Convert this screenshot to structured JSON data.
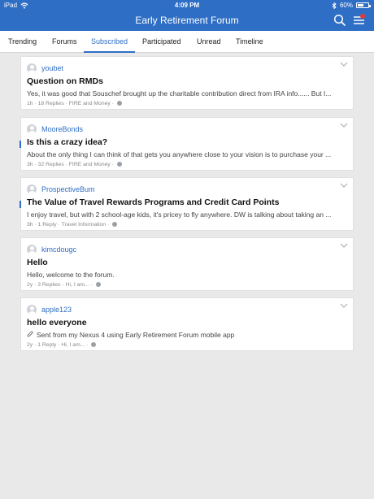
{
  "status_bar": {
    "carrier": "iPad",
    "time": "4:09 PM",
    "battery": "60%",
    "battery_level": 0.6
  },
  "header": {
    "title": "Early Retirement Forum",
    "icons": [
      "search-icon",
      "menu-icon"
    ]
  },
  "tabs": [
    {
      "label": "Trending",
      "active": false
    },
    {
      "label": "Forums",
      "active": false
    },
    {
      "label": "Subscribed",
      "active": true
    },
    {
      "label": "Participated",
      "active": false
    },
    {
      "label": "Unread",
      "active": false
    },
    {
      "label": "Timeline",
      "active": false
    }
  ],
  "topics": [
    {
      "author": "youbet",
      "title": "Question on RMDs",
      "excerpt": "Yes, it was good that Souschef brought up the charitable contribution direct from IRA info...... But I...",
      "age": "1h",
      "replies": "18 Replies",
      "forum": "FIRE and Money",
      "unread": false
    },
    {
      "author": "MooreBonds",
      "title": "Is this a crazy idea?",
      "excerpt": "About the only thing I can think of that gets you anywhere close to your vision is to purchase your ...",
      "age": "3h",
      "replies": "32 Replies",
      "forum": "FIRE and Money",
      "unread": true
    },
    {
      "author": "ProspectiveBum",
      "title": "The Value of Travel Rewards Programs and Credit Card Points",
      "excerpt": "I enjoy travel, but with 2 school-age kids, it's pricey to fly anywhere. DW is talking about taking an ...",
      "age": "3h",
      "replies": "1 Reply",
      "forum": "Travel Information",
      "unread": true
    },
    {
      "author": "kimcdougc",
      "title": "Hello",
      "excerpt": "Hello, welcome to the forum.",
      "age": "2y",
      "replies": "3 Replies",
      "forum": "Hi, I am...",
      "unread": false
    },
    {
      "author": "apple123",
      "title": "hello everyone",
      "excerpt": "Sent from my Nexus 4 using Early Retirement Forum mobile app",
      "age": "2y",
      "replies": "1 Reply",
      "forum": "Hi, I am...",
      "unread": false,
      "attachment_icon": "paperclip-icon"
    }
  ],
  "colors": {
    "brand": "#2f6ec5",
    "background": "#e9e9ea",
    "notification": "#e53935"
  }
}
